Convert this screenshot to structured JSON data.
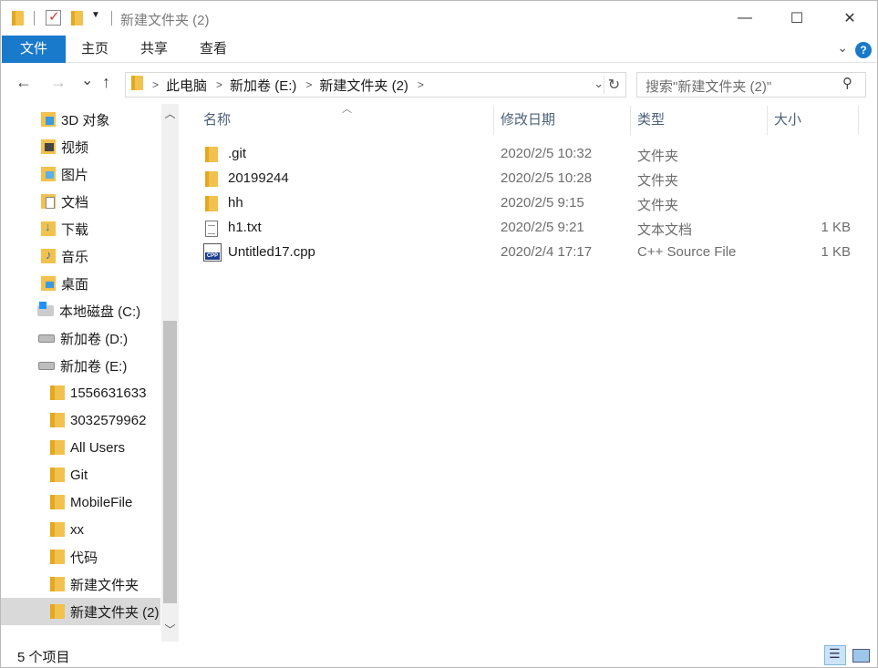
{
  "window": {
    "title": "新建文件夹 (2)",
    "controls": {
      "minimize": "—",
      "maximize": "☐",
      "close": "✕"
    }
  },
  "ribbon": {
    "tabs": [
      "文件",
      "主页",
      "共享",
      "查看"
    ],
    "expand_icon": "chevron-down-icon",
    "help_label": "?"
  },
  "nav": {
    "back": "←",
    "forward": "→",
    "recent": "⌄",
    "up": "↑"
  },
  "address": {
    "segments": [
      "此电脑",
      "新加卷 (E:)",
      "新建文件夹 (2)"
    ]
  },
  "search": {
    "placeholder": "搜索\"新建文件夹 (2)\""
  },
  "sidebar": {
    "items": [
      {
        "label": "3D 对象",
        "icon": "3d"
      },
      {
        "label": "视频",
        "icon": "video"
      },
      {
        "label": "图片",
        "icon": "pic"
      },
      {
        "label": "文档",
        "icon": "doc"
      },
      {
        "label": "下载",
        "icon": "dl"
      },
      {
        "label": "音乐",
        "icon": "music"
      },
      {
        "label": "桌面",
        "icon": "desk"
      },
      {
        "label": "本地磁盘 (C:)",
        "icon": "drivec"
      },
      {
        "label": "新加卷 (D:)",
        "icon": "drive"
      },
      {
        "label": "新加卷 (E:)",
        "icon": "drive"
      },
      {
        "label": "1556631633",
        "icon": "folder"
      },
      {
        "label": "3032579962",
        "icon": "folder"
      },
      {
        "label": "All Users",
        "icon": "folder"
      },
      {
        "label": "Git",
        "icon": "folder"
      },
      {
        "label": "MobileFile",
        "icon": "folder"
      },
      {
        "label": "xx",
        "icon": "folder"
      },
      {
        "label": "代码",
        "icon": "folder"
      },
      {
        "label": "新建文件夹",
        "icon": "folder"
      },
      {
        "label": "新建文件夹 (2)",
        "icon": "folder",
        "selected": true
      }
    ]
  },
  "columns": {
    "name": "名称",
    "date": "修改日期",
    "type": "类型",
    "size": "大小"
  },
  "files": [
    {
      "name": ".git",
      "date": "2020/2/5 10:32",
      "type": "文件夹",
      "size": "",
      "icon": "folder"
    },
    {
      "name": "20199244",
      "date": "2020/2/5 10:28",
      "type": "文件夹",
      "size": "",
      "icon": "folder"
    },
    {
      "name": "hh",
      "date": "2020/2/5 9:15",
      "type": "文件夹",
      "size": "",
      "icon": "folder"
    },
    {
      "name": "h1.txt",
      "date": "2020/2/5 9:21",
      "type": "文本文档",
      "size": "1 KB",
      "icon": "txt"
    },
    {
      "name": "Untitled17.cpp",
      "date": "2020/2/4 17:17",
      "type": "C++ Source File",
      "size": "1 KB",
      "icon": "cpp"
    }
  ],
  "status": {
    "count_text": "5 个项目"
  },
  "colors": {
    "accent": "#1979ca",
    "selection": "#d9d9d9",
    "folder": "#f2c14e"
  }
}
